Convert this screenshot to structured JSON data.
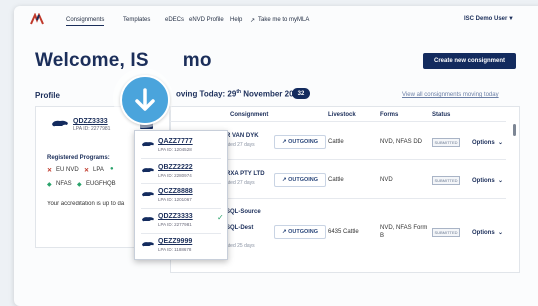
{
  "nav": {
    "items": [
      "Consignments",
      "Templates",
      "eDECs",
      "eNVD Profile",
      "Help",
      "Take me to myMLA"
    ],
    "user": "ISC Demo User"
  },
  "welcome": "Welcome, IS",
  "welcome_end": "mo",
  "create_button": "Create new consignment",
  "profile": {
    "heading": "Profile",
    "code": "QDZZ3333",
    "lpa": "LPA ID: 2277981",
    "registered_heading": "Registered Programs:",
    "programs": [
      "EU NVD",
      "LPA",
      "NFAS",
      "EUGFHQB"
    ],
    "accreditation": "Your accreditation is up to da"
  },
  "moving": {
    "heading_pre": "oving Today: 29",
    "heading_sup": "th",
    "heading_post": " November 2023",
    "count": "32",
    "view_all": "View all consignments moving today"
  },
  "table": {
    "headers": [
      "Consignment",
      "Livestock",
      "Forms",
      "Status"
    ],
    "rows": [
      {
        "name": "R VAN DYK",
        "sub": "ated 27 days",
        "direction": "OUTGOING",
        "livestock": "Cattle",
        "forms": "NVD, NFAS DD",
        "status": "SUBMITTED",
        "options": "Options"
      },
      {
        "name": "RXA PTY LTD",
        "sub": "ated 27 days",
        "direction": "OUTGOING",
        "livestock": "Cattle",
        "forms": "NVD",
        "status": "SUBMITTED",
        "options": "Options"
      },
      {
        "name": "SQL-Source",
        "name2": "SQL-Dest",
        "sub": "ated 25 days",
        "direction": "OUTGOING",
        "livestock": "6435 Cattle",
        "forms": "NVD, NFAS Form",
        "forms2": "B",
        "status": "SUBMITTED",
        "options": "Options"
      }
    ]
  },
  "dropdown": {
    "items": [
      {
        "code": "QAZZ7777",
        "lpa": "LPA ID: 1204528"
      },
      {
        "code": "QBZZ2222",
        "lpa": "LPA ID: 2280974"
      },
      {
        "code": "QCZZ8888",
        "lpa": "LPA ID: 1201067"
      },
      {
        "code": "QDZZ3333",
        "lpa": "LPA ID: 2277981"
      },
      {
        "code": "QEZZ9999",
        "lpa": "LPA ID: 1188678"
      }
    ]
  },
  "colors": {
    "navy": "#132b5e",
    "accent": "#4aa4dc",
    "check": "#2aa36b"
  }
}
